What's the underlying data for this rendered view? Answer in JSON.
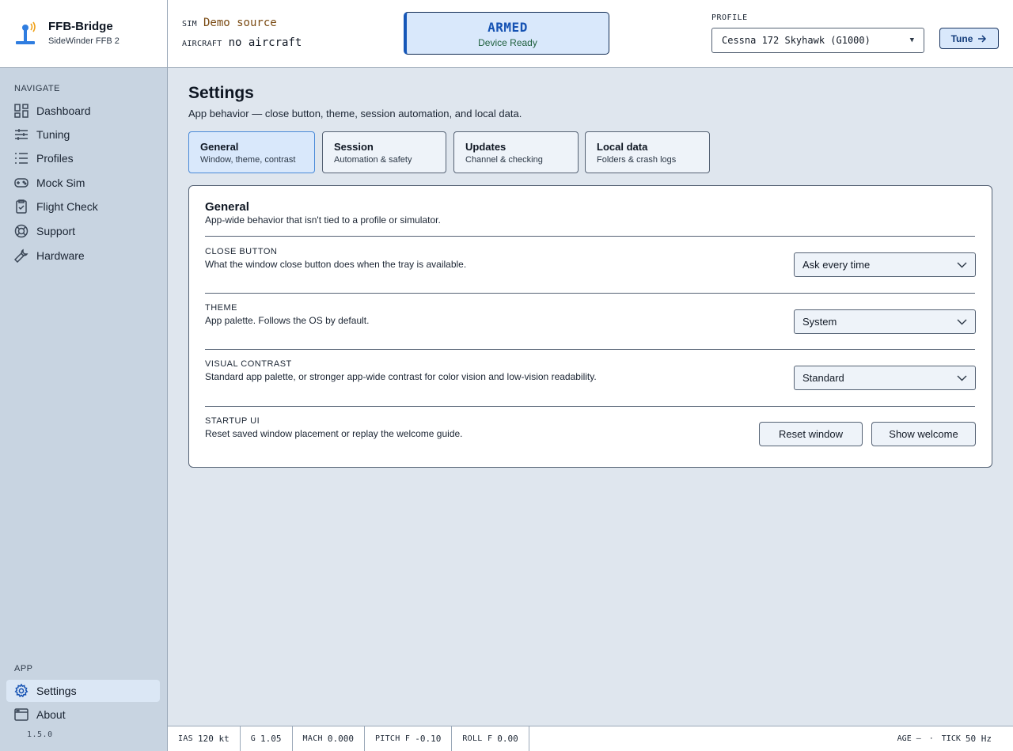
{
  "brand": {
    "name": "FFB-Bridge",
    "subtitle": "SideWinder FFB 2"
  },
  "topbar": {
    "sim_key": "SIM",
    "sim_value": "Demo source",
    "aircraft_key": "AIRCRAFT",
    "aircraft_value": "no aircraft",
    "armed_title": "ARMED",
    "armed_sub": "Device Ready",
    "profile_label": "PROFILE",
    "profile_value": "Cessna 172 Skyhawk (G1000)",
    "tune_label": "Tune"
  },
  "sidebar": {
    "navigate_heading": "NAVIGATE",
    "items": [
      {
        "label": "Dashboard",
        "icon": "grid-icon"
      },
      {
        "label": "Tuning",
        "icon": "sliders-icon"
      },
      {
        "label": "Profiles",
        "icon": "list-icon"
      },
      {
        "label": "Mock Sim",
        "icon": "gamepad-icon"
      },
      {
        "label": "Flight Check",
        "icon": "clipboard-check-icon"
      },
      {
        "label": "Support",
        "icon": "lifebuoy-icon"
      },
      {
        "label": "Hardware",
        "icon": "wrench-icon"
      }
    ],
    "app_heading": "APP",
    "app_items": [
      {
        "label": "Settings",
        "icon": "gear-icon",
        "active": true
      },
      {
        "label": "About",
        "icon": "window-icon"
      }
    ],
    "version": "1.5.0"
  },
  "main": {
    "title": "Settings",
    "subtitle": "App behavior — close button, theme, session automation, and local data.",
    "tabs": [
      {
        "title": "General",
        "sub": "Window, theme, contrast",
        "active": true
      },
      {
        "title": "Session",
        "sub": "Automation & safety"
      },
      {
        "title": "Updates",
        "sub": "Channel & checking"
      },
      {
        "title": "Local data",
        "sub": "Folders & crash logs"
      }
    ],
    "card": {
      "title": "General",
      "subtitle": "App-wide behavior that isn't tied to a profile or simulator.",
      "settings": [
        {
          "label": "CLOSE BUTTON",
          "desc": "What the window close button does when the tray is available.",
          "value": "Ask every time"
        },
        {
          "label": "THEME",
          "desc": "App palette. Follows the OS by default.",
          "value": "System"
        },
        {
          "label": "VISUAL CONTRAST",
          "desc": "Standard app palette, or stronger app-wide contrast for color vision and low-vision readability.",
          "value": "Standard"
        },
        {
          "label": "STARTUP UI",
          "desc": "Reset saved window placement or replay the welcome guide."
        }
      ],
      "reset_window": "Reset window",
      "show_welcome": "Show welcome"
    }
  },
  "statusbar": {
    "ias_key": "IAS",
    "ias_value": "120 kt",
    "g_key": "G",
    "g_value": "1.05",
    "mach_key": "MACH",
    "mach_value": "0.000",
    "pitch_key": "PITCH F",
    "pitch_value": "-0.10",
    "roll_key": "ROLL F",
    "roll_value": "0.00",
    "age_key": "AGE",
    "age_value": "—",
    "sep": "·",
    "tick_key": "TICK",
    "tick_value": "50 Hz"
  },
  "colors": {
    "accent": "#1552b3",
    "armed_bg": "#d9e8fb",
    "ready_green": "#1d5f3c",
    "sim_value": "#7a4a12"
  }
}
